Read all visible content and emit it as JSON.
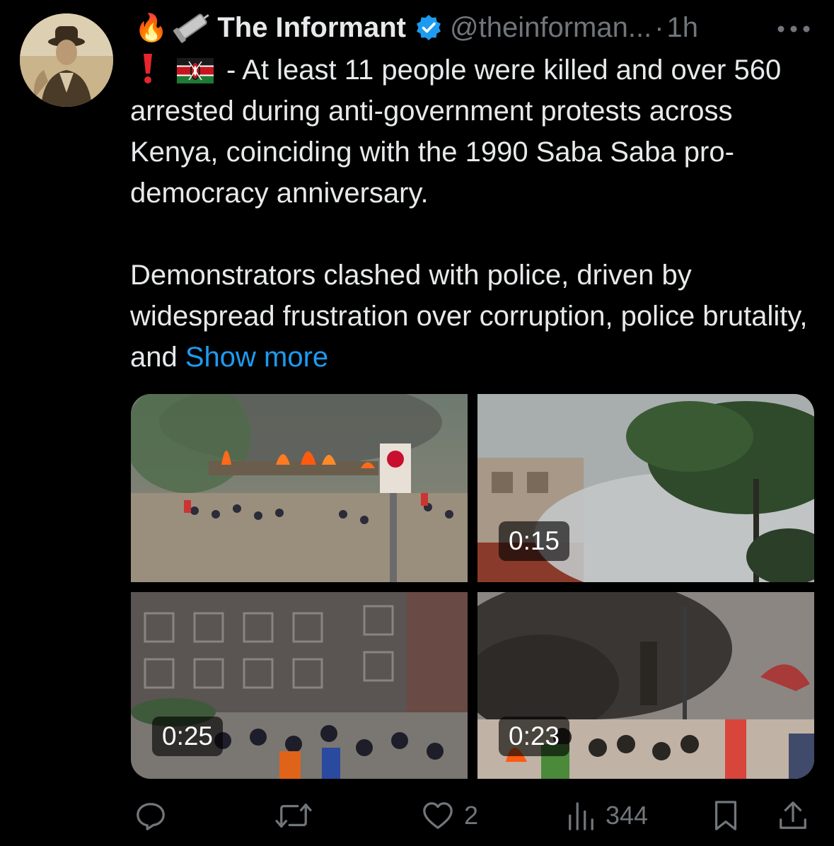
{
  "tweet": {
    "author": {
      "display_name": "The Informant",
      "handle": "@theinforman...",
      "time": "1h",
      "leading_icons": [
        "fire-icon",
        "pushpin-icon"
      ]
    },
    "text": {
      "lead": "- At least 11 people were killed and over 560 arrested during anti-government protests across Kenya, coinciding with the 1990 Saba Saba pro-democracy anniversary.",
      "para2": "Demonstrators clashed with police, driven by widespread frustration over corruption, police brutality, and ",
      "show_more": "Show more"
    },
    "media": [
      {
        "kind": "video-thumb",
        "duration": ""
      },
      {
        "kind": "video-thumb",
        "duration": "0:15"
      },
      {
        "kind": "video-thumb",
        "duration": "0:25"
      },
      {
        "kind": "video-thumb",
        "duration": "0:23"
      }
    ],
    "actions": {
      "replies": "",
      "reposts": "",
      "likes": "2",
      "views": "344"
    },
    "colors": {
      "background": "#000000",
      "text": "#e7e9ea",
      "muted": "#71767b",
      "link": "#1d9bf0",
      "verified": "#1d9bf0"
    }
  }
}
